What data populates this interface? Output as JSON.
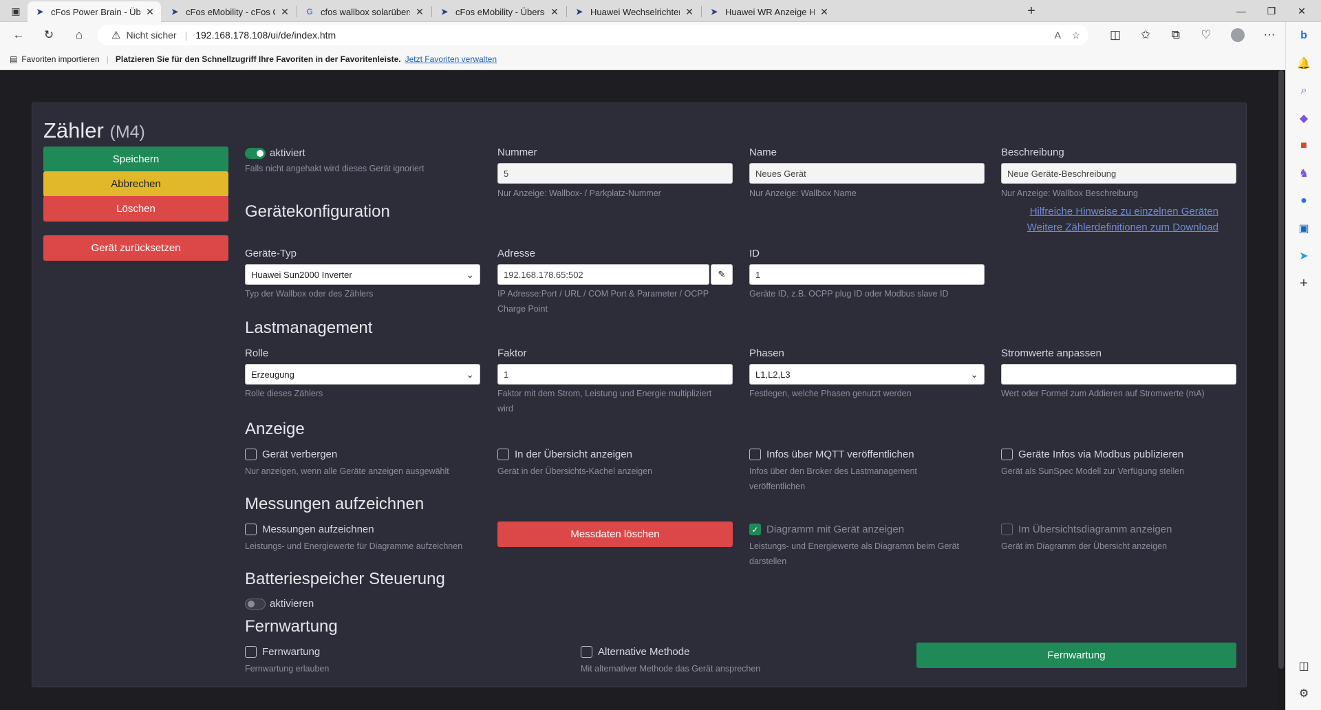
{
  "browser": {
    "tabs": [
      {
        "title": "cFos Power Brain - Übersicht",
        "icon": "cfos-icon",
        "active": true
      },
      {
        "title": "cFos eMobility - cFos Charging M",
        "icon": "cfos-icon"
      },
      {
        "title": "cfos wallbox solarüberschuss - G",
        "icon": "google-icon"
      },
      {
        "title": "cFos eMobility - Überschusslade",
        "icon": "cfos-icon"
      },
      {
        "title": "Huawei Wechselrichter und Bezu",
        "icon": "forum-icon"
      },
      {
        "title": "Huawei WR Anzeige Haus - cFos",
        "icon": "forum-icon"
      }
    ],
    "security_label": "Nicht sicher",
    "url": "192.168.178.108/ui/de/index.htm",
    "favbar": {
      "import_label": "Favoriten importieren",
      "text": "Platzieren Sie für den Schnellzugriff Ihre Favoriten in der Favoritenleiste.",
      "link": "Jetzt Favoriten verwalten"
    }
  },
  "page": {
    "title": "Zähler",
    "title_suffix": "(M4)",
    "buttons": {
      "save": "Speichern",
      "cancel": "Abbrechen",
      "delete": "Löschen",
      "reset": "Gerät zurücksetzen"
    },
    "activated": {
      "label": "aktiviert",
      "hint": "Falls nicht angehakt wird dieses Gerät ignoriert",
      "on": true
    },
    "nummer": {
      "label": "Nummer",
      "value": "5",
      "hint": "Nur Anzeige: Wallbox- / Parkplatz-Nummer"
    },
    "name": {
      "label": "Name",
      "value": "Neues Gerät",
      "hint": "Nur Anzeige: Wallbox Name"
    },
    "beschreibung": {
      "label": "Beschreibung",
      "value": "Neue Geräte-Beschreibung",
      "hint": "Nur Anzeige: Wallbox Beschreibung"
    },
    "links": {
      "hints": "Hilfreiche Hinweise zu einzelnen Geräten",
      "downloads": "Weitere Zählerdefinitionen zum Download"
    },
    "geraetekonfiguration": {
      "heading": "Gerätekonfiguration",
      "typ": {
        "label": "Geräte-Typ",
        "value": "Huawei Sun2000 Inverter",
        "hint": "Typ der Wallbox oder des Zählers"
      },
      "adresse": {
        "label": "Adresse",
        "value": "192.168.178.65:502",
        "hint1": "IP Adresse:Port / URL / COM Port & Parameter / OCPP",
        "hint2": "Charge Point"
      },
      "id": {
        "label": "ID",
        "value": "1",
        "hint": "Geräte ID, z.B. OCPP plug ID oder Modbus slave ID"
      }
    },
    "lastmanagement": {
      "heading": "Lastmanagement",
      "rolle": {
        "label": "Rolle",
        "value": "Erzeugung",
        "hint": "Rolle dieses Zählers"
      },
      "faktor": {
        "label": "Faktor",
        "value": "1",
        "hint1": "Faktor mit dem Strom, Leistung und Energie multipliziert",
        "hint2": "wird"
      },
      "phasen": {
        "label": "Phasen",
        "value": "L1,L2,L3",
        "hint": "Festlegen, welche Phasen genutzt werden"
      },
      "strom": {
        "label": "Stromwerte anpassen",
        "value": "",
        "hint": "Wert oder Formel zum Addieren auf Stromwerte (mA)"
      }
    },
    "anzeige": {
      "heading": "Anzeige",
      "verbergen": {
        "label": "Gerät verbergen",
        "hint": "Nur anzeigen, wenn alle Geräte anzeigen ausgewählt",
        "checked": false
      },
      "uebersicht": {
        "label": "In der Übersicht anzeigen",
        "hint": "Gerät in der Übersichts-Kachel anzeigen",
        "checked": false
      },
      "mqtt": {
        "label": "Infos über MQTT veröffentlichen",
        "hint1": "Infos über den Broker des Lastmanagement",
        "hint2": "veröffentlichen",
        "checked": false
      },
      "modbus": {
        "label": "Geräte Infos via Modbus publizieren",
        "hint": "Gerät als SunSpec Modell zur Verfügung stellen",
        "checked": false
      }
    },
    "messungen": {
      "heading": "Messungen aufzeichnen",
      "aufzeichnen": {
        "label": "Messungen aufzeichnen",
        "hint": "Leistungs- und Energiewerte für Diagramme aufzeichnen",
        "checked": false
      },
      "loeschen_button": "Messdaten löschen",
      "diagramm": {
        "label": "Diagramm mit Gerät anzeigen",
        "hint1": "Leistungs- und Energiewerte als Diagramm beim Gerät",
        "hint2": "darstellen",
        "checked": true
      },
      "uebersichtsdiagramm": {
        "label": "Im Übersichtsdiagramm anzeigen",
        "hint": "Gerät im Diagramm der Übersicht anzeigen",
        "checked": false
      }
    },
    "batterie": {
      "heading": "Batteriespeicher Steuerung",
      "toggle_label": "aktivieren",
      "on": false
    },
    "fernwartung": {
      "heading": "Fernwartung",
      "fernwartung": {
        "label": "Fernwartung",
        "hint": "Fernwartung erlauben",
        "checked": false
      },
      "alternative": {
        "label": "Alternative Methode",
        "hint": "Mit alternativer Methode das Gerät ansprechen",
        "checked": false
      },
      "button": "Fernwartung"
    }
  },
  "colors": {
    "accent_green": "#1f8a57",
    "warning_yellow": "#e0b82a",
    "danger_red": "#dc4848",
    "card_bg": "#2d2d3a",
    "link": "#6f8ad6"
  }
}
